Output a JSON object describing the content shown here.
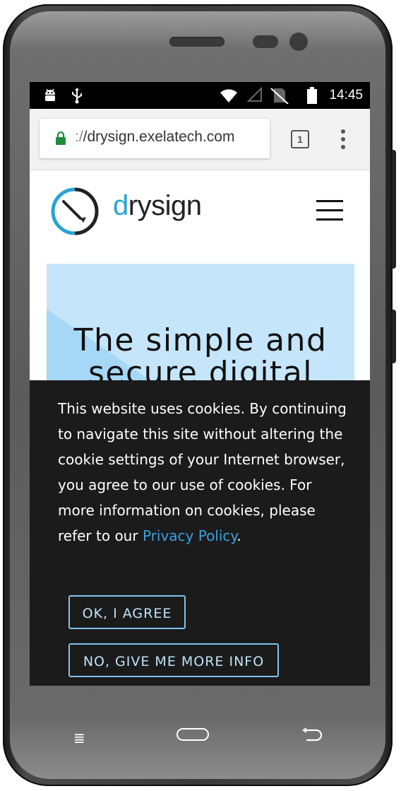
{
  "statusbar": {
    "time": "14:45",
    "icons": [
      "android-icon",
      "usb-icon",
      "wifi-icon",
      "signal-icon",
      "no-sim-icon",
      "battery-icon"
    ]
  },
  "browser": {
    "url_prefix": ":/",
    "url_host": "/drysign.exelatech.com",
    "tab_count": "1",
    "icons": [
      "lock-icon",
      "tabs-icon",
      "overflow-menu-icon"
    ],
    "lock_color": "#1e8e3e"
  },
  "site": {
    "logo_text_a": "d",
    "logo_text_b": "rysign",
    "hero_title": "The simple and secure digital",
    "brand_color": "#2aa3d6",
    "hero_color": "#c5e6fa"
  },
  "cookie_banner": {
    "text": "This website uses cookies. By continuing to navigate this site without altering the cookie settings of your Internet browser, you agree to our use of cookies. For more information on cookies, please refer to our ",
    "link_text": "Privacy Policy",
    "text_end": ".",
    "agree_label": "OK, I AGREE",
    "info_label": "NO, GIVE ME MORE INFO",
    "link_color": "#3aa0e0"
  },
  "navbar": {
    "icons": [
      "menu-icon",
      "home-icon",
      "back-icon"
    ],
    "menu_glyph": "≣"
  }
}
